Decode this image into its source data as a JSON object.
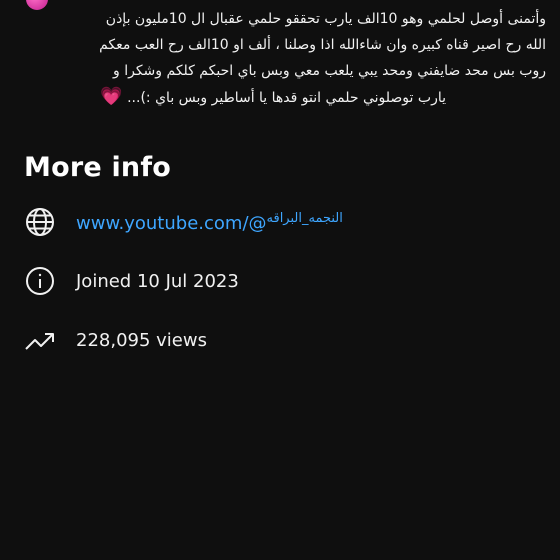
{
  "description": {
    "lines": [
      "وأتمنى أوصل لحلمي وهو 10الف يارب تحققو حلمي عقبال ال 10مليون بإذن",
      "الله رح اصير قناه كبيره وان شاءالله اذا وصلنا ، ألف او 10الف رح العب معكم",
      "روب بس محد ضايفني ومحد يبي يلعب معي وبس باي احبكم كلكم وشكرا و",
      "يارب توصلوني حلمي انتو قدها يا أساطير وبس باي :)..."
    ],
    "heart": "💗"
  },
  "more_info": {
    "title": "More info",
    "link_prefix": "www.youtube.com/@",
    "link_handle": "النجمه_البراقه",
    "joined": "Joined 10 Jul 2023",
    "views": "228,095 views"
  },
  "colors": {
    "background": "#0f0f0f",
    "text": "#f1f1f1",
    "link": "#3ea6ff"
  },
  "icons": {
    "link": "globe-icon",
    "joined": "info-icon",
    "views": "trending-up-icon"
  }
}
